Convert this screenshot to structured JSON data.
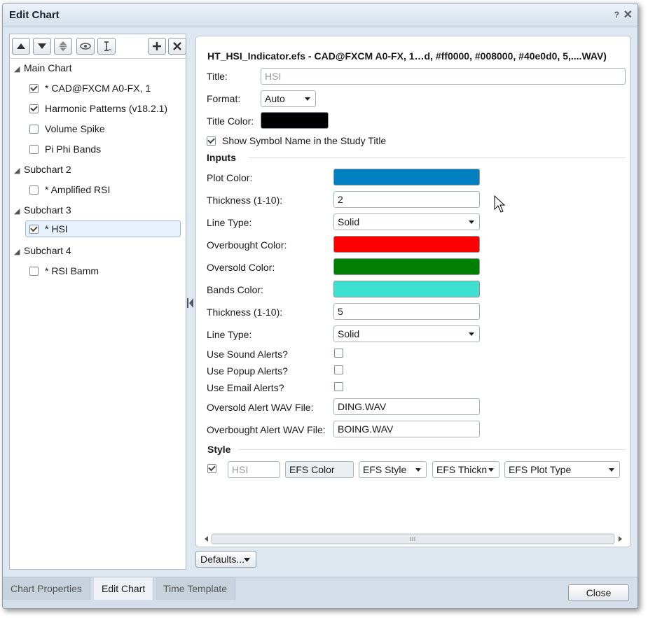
{
  "window": {
    "title": "Edit Chart",
    "help": "?",
    "close": "✕"
  },
  "toolbar": {
    "icons": [
      "move-up-icon",
      "move-down-icon",
      "reorder-icon",
      "eye-icon",
      "text-cursor-icon",
      "plus-icon",
      "delete-icon"
    ]
  },
  "tree": {
    "groups": [
      {
        "label": "Main Chart"
      },
      {
        "label": "Subchart 2"
      },
      {
        "label": "Subchart 3"
      },
      {
        "label": "Subchart 4"
      }
    ],
    "items": [
      {
        "label": "* CAD@FXCM A0-FX, 1",
        "checked": true
      },
      {
        "label": "Harmonic Patterns (v18.2.1)",
        "checked": true
      },
      {
        "label": "Volume Spike",
        "checked": false
      },
      {
        "label": "Pi Phi Bands",
        "checked": false
      },
      {
        "label": "* Amplified RSI",
        "checked": false
      },
      {
        "label": "* HSI",
        "checked": true
      },
      {
        "label": "* RSI Bamm",
        "checked": false
      }
    ]
  },
  "study": {
    "header": "HT_HSI_Indicator.efs - CAD@FXCM A0-FX, 1…d, #ff0000, #008000, #40e0d0, 5,....WAV)",
    "title_label": "Title:",
    "title_placeholder": "HSI",
    "format_label": "Format:",
    "format_value": "Auto",
    "title_color_label": "Title Color:",
    "title_color": "#000000",
    "show_symbol_label": "Show Symbol Name in the Study Title",
    "show_symbol_checked": true
  },
  "inputs": {
    "section": "Inputs",
    "plot_color_label": "Plot Color:",
    "plot_color": "#0080c0",
    "thickness1_label": "Thickness (1-10):",
    "thickness1_value": "2",
    "linetype1_label": "Line Type:",
    "linetype1_value": "Solid",
    "overbought_color_label": "Overbought Color:",
    "overbought_color": "#ff0000",
    "oversold_color_label": "Oversold Color:",
    "oversold_color": "#008000",
    "bands_color_label": "Bands Color:",
    "bands_color": "#40e0d0",
    "thickness2_label": "Thickness (1-10):",
    "thickness2_value": "5",
    "linetype2_label": "Line Type:",
    "linetype2_value": "Solid",
    "sound_alerts_label": "Use Sound Alerts?",
    "popup_alerts_label": "Use Popup Alerts?",
    "email_alerts_label": "Use Email Alerts?",
    "oversold_wav_label": "Oversold Alert WAV File:",
    "oversold_wav_value": "DING.WAV",
    "overbought_wav_label": "Overbought Alert WAV File:",
    "overbought_wav_value": "BOING.WAV"
  },
  "style": {
    "section": "Style",
    "name_placeholder": "HSI",
    "color_label": "EFS Color",
    "style_label": "EFS Style",
    "thickness_label": "EFS Thickn",
    "plot_type_label": "EFS Plot Type"
  },
  "footer": {
    "defaults_label": "Defaults...",
    "tabs": [
      {
        "label": "Chart Properties"
      },
      {
        "label": "Edit Chart"
      },
      {
        "label": "Time Template"
      }
    ],
    "close_label": "Close"
  }
}
